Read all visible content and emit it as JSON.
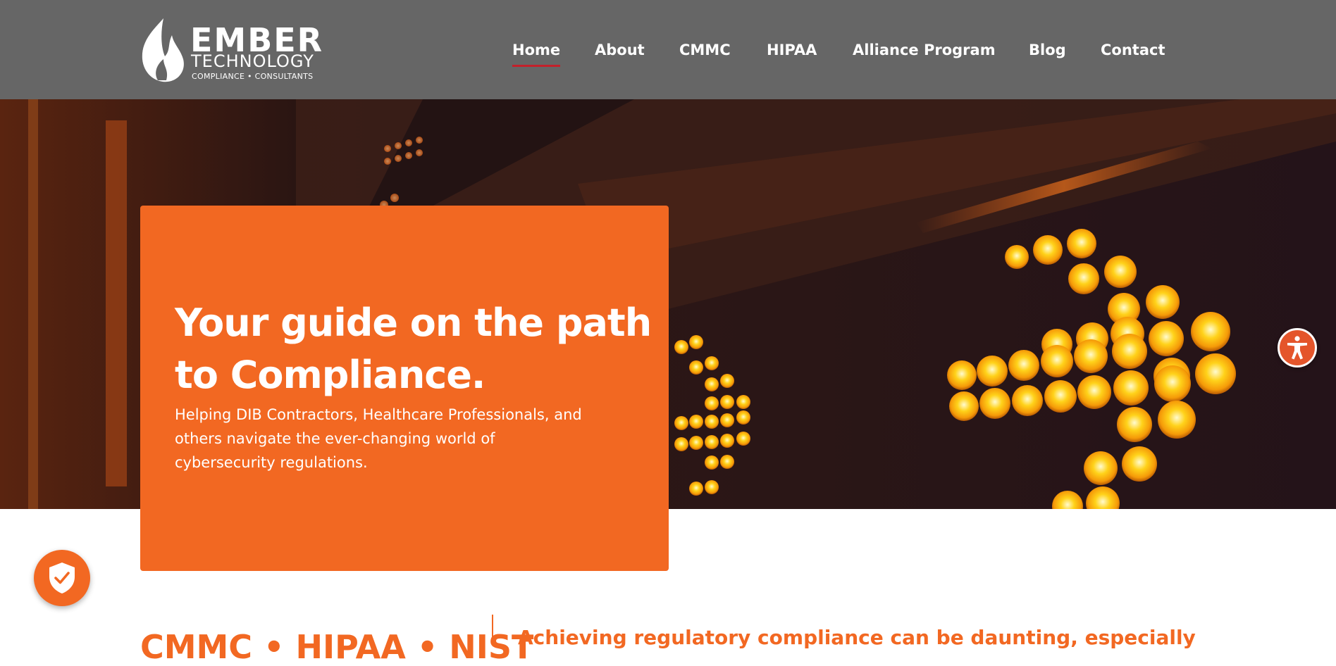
{
  "brand": {
    "name": "EMBER",
    "sub": "TECHNOLOGY",
    "tagline": "COMPLIANCE • CONSULTANTS"
  },
  "nav": {
    "items": [
      {
        "label": "Home",
        "active": true
      },
      {
        "label": "About"
      },
      {
        "label": "CMMC"
      },
      {
        "label": "HIPAA"
      },
      {
        "label": "Alliance Program"
      },
      {
        "label": "Blog"
      },
      {
        "label": "Contact"
      }
    ]
  },
  "hero": {
    "title": "Your guide on the path to Compliance.",
    "text": "Helping DIB Contractors, Healthcare Professionals, and others navigate the ever-changing world of cybersecurity regulations."
  },
  "section": {
    "left_heading": "CMMC • HIPAA • NIST",
    "right_heading": "Achieving regulatory compliance can be daunting, especially"
  },
  "colors": {
    "accent": "#f26822",
    "header_bg": "#666666",
    "nav_active_underline": "#c4202a"
  },
  "icons": {
    "accessibility": "accessibility-icon",
    "security_badge": "shield-check-icon",
    "logo_mark": "flame-logo-icon"
  }
}
